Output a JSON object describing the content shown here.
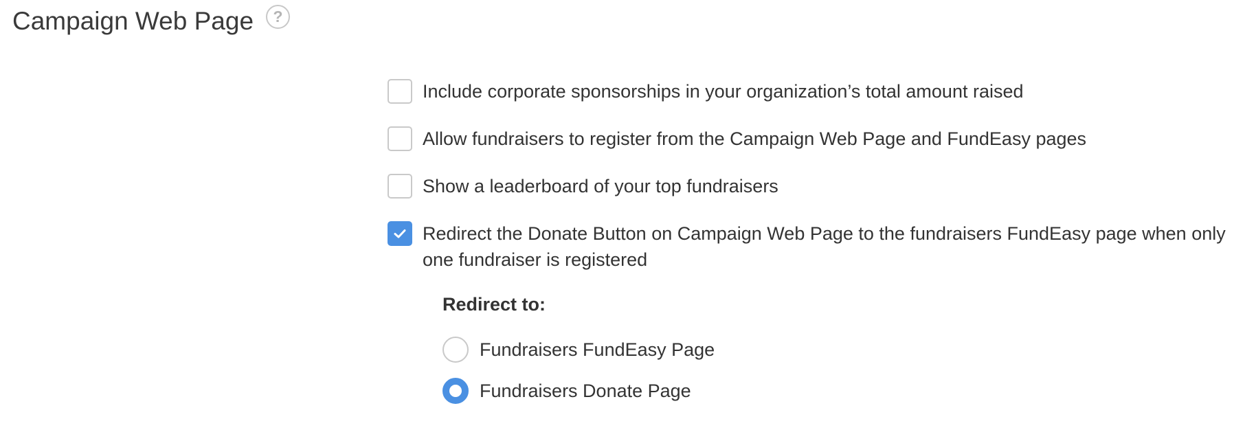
{
  "header": {
    "title": "Campaign Web Page",
    "help_glyph": "?",
    "help_icon": "question-circle-icon"
  },
  "options": [
    {
      "label": "Include corporate sponsorships in your organization’s total amount raised",
      "checked": false
    },
    {
      "label": "Allow fundraisers to register from the Campaign Web Page and FundEasy pages",
      "checked": false
    },
    {
      "label": "Show a leaderboard of your top fundraisers",
      "checked": false
    },
    {
      "label": "Redirect the Donate Button on Campaign Web Page to the fundraisers FundEasy page when only one fundraiser is registered",
      "checked": true
    }
  ],
  "redirect": {
    "heading": "Redirect to:",
    "choices": [
      {
        "label": "Fundraisers FundEasy Page",
        "selected": false
      },
      {
        "label": "Fundraisers Donate Page",
        "selected": true
      }
    ]
  },
  "colors": {
    "accent": "#4a90e2",
    "border": "#c9c9c9",
    "text": "#333333"
  }
}
